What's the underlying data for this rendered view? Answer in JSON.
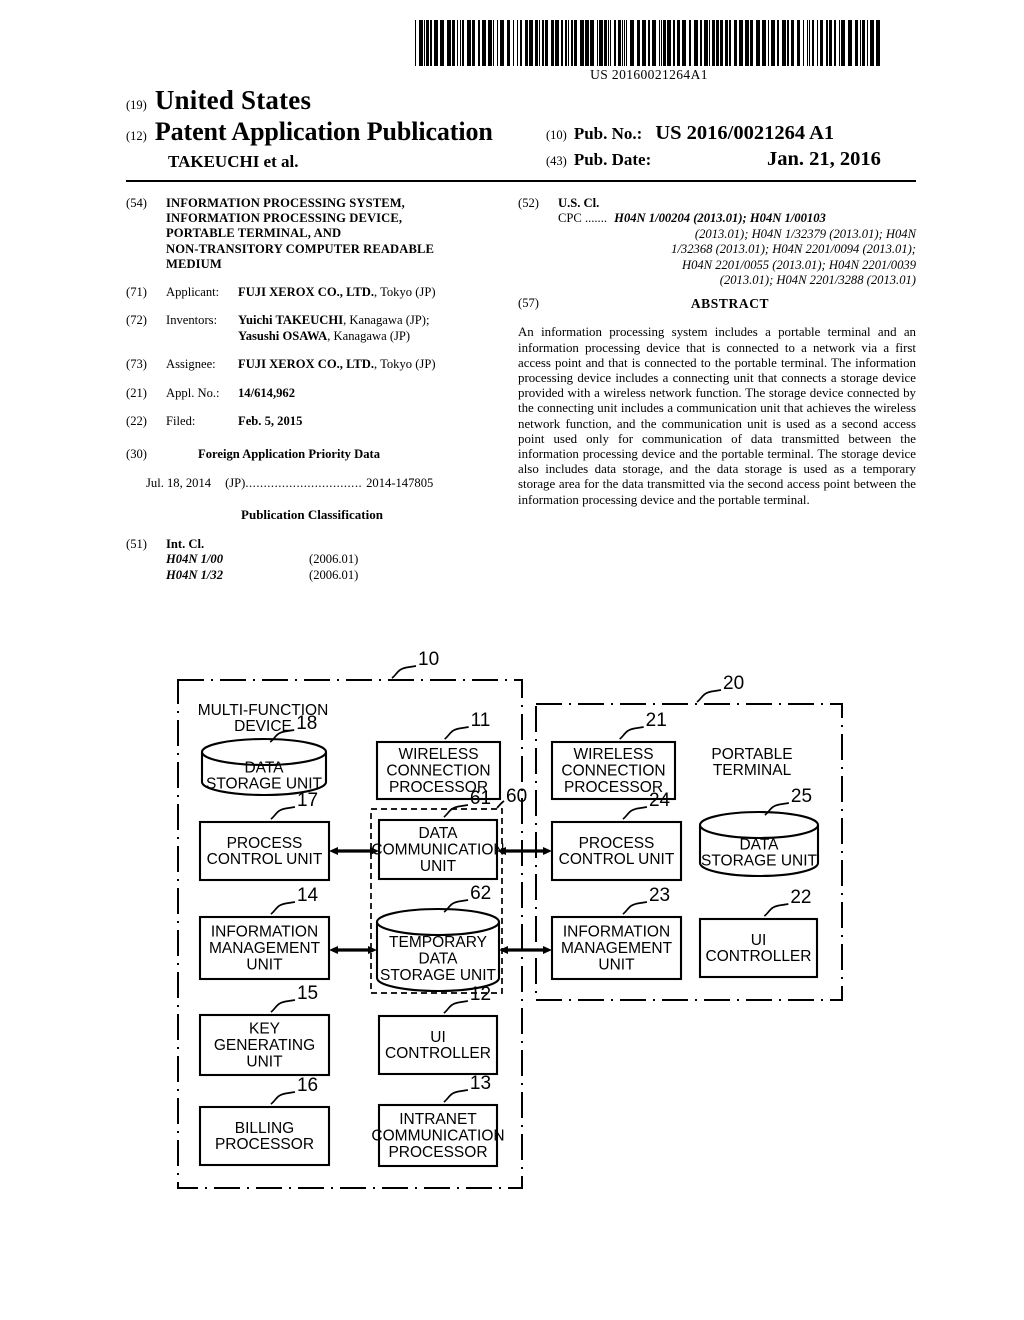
{
  "header": {
    "barcode_number": "US 20160021264A1",
    "country_code": "(19)",
    "country": "United States",
    "doc_code": "(12)",
    "doc_type": "Patent Application Publication",
    "author_line": "TAKEUCHI et al.",
    "pubno_code": "(10)",
    "pubno_label": "Pub. No.:",
    "pubno_value": "US 2016/0021264 A1",
    "pubdate_code": "(43)",
    "pubdate_label": "Pub. Date:",
    "pubdate_value": "Jan. 21, 2016"
  },
  "left_column": {
    "title_code": "(54)",
    "title_lines": [
      "INFORMATION PROCESSING SYSTEM,",
      "INFORMATION PROCESSING DEVICE,",
      "PORTABLE TERMINAL, AND",
      "NON-TRANSITORY COMPUTER READABLE",
      "MEDIUM"
    ],
    "applicant_code": "(71)",
    "applicant_label": "Applicant:",
    "applicant_name": "FUJI XEROX CO., LTD.",
    "applicant_loc": ", Tokyo (JP)",
    "inventors_code": "(72)",
    "inventors_label": "Inventors:",
    "inventors": [
      {
        "name": "Yuichi TAKEUCHI",
        "loc": ", Kanagawa (JP);"
      },
      {
        "name": "Yasushi OSAWA",
        "loc": ", Kanagawa (JP)"
      }
    ],
    "assignee_code": "(73)",
    "assignee_label": "Assignee:",
    "assignee_name": "FUJI XEROX CO., LTD.",
    "assignee_loc": ", Tokyo (JP)",
    "appno_code": "(21)",
    "appno_label": "Appl. No.:",
    "appno_value": "14/614,962",
    "filed_code": "(22)",
    "filed_label": "Filed:",
    "filed_value": "Feb. 5, 2015",
    "priority_code": "(30)",
    "priority_heading": "Foreign Application Priority Data",
    "priority_date": "Jul. 18, 2014",
    "priority_country": "(JP)",
    "priority_dots": "................................",
    "priority_number": "2014-147805",
    "pubclass_heading": "Publication Classification",
    "intcl_code": "(51)",
    "intcl_label": "Int. Cl.",
    "intcl_rows": [
      {
        "code": "H04N 1/00",
        "version": "(2006.01)"
      },
      {
        "code": "H04N 1/32",
        "version": "(2006.01)"
      }
    ]
  },
  "right_column": {
    "uscl_code": "(52)",
    "uscl_label": "U.S. Cl.",
    "cpc_prefix": "CPC .......",
    "cpc_lines": [
      "H04N 1/00204 (2013.01); H04N 1/00103",
      "(2013.01); H04N 1/32379 (2013.01); H04N",
      "1/32368 (2013.01); H04N 2201/0094 (2013.01);",
      "H04N 2201/0055 (2013.01); H04N 2201/0039",
      "(2013.01); H04N 2201/3288 (2013.01)"
    ],
    "abstract_code": "(57)",
    "abstract_title": "ABSTRACT",
    "abstract_text": "An information processing system includes a portable terminal and an information processing device that is connected to a network via a first access point and that is connected to the portable terminal. The information processing device includes a connecting unit that connects a storage device provided with a wireless network function. The storage device connected by the connecting unit includes a communication unit that achieves the wireless network function, and the communication unit is used as a second access point used only for communication of data transmitted between the information processing device and the portable terminal. The storage device also includes data storage, and the data storage is used as a temporary storage area for the data transmitted via the second access point between the information processing device and the portable terminal."
  },
  "figure": {
    "mfd_group_ref": "10",
    "mfd_group_label_lines": [
      "MULTI-FUNCTION",
      "DEVICE"
    ],
    "terminal_group_ref": "20",
    "terminal_group_label_lines": [
      "PORTABLE",
      "TERMINAL"
    ],
    "storage_group_ref": "60",
    "blocks": [
      {
        "ref": "18",
        "lines": [
          "DATA",
          "STORAGE UNIT"
        ],
        "shape": "cylinder"
      },
      {
        "ref": "11",
        "lines": [
          "WIRELESS",
          "CONNECTION",
          "PROCESSOR"
        ],
        "shape": "rect"
      },
      {
        "ref": "17",
        "lines": [
          "PROCESS",
          "CONTROL UNIT"
        ],
        "shape": "rect"
      },
      {
        "ref": "61",
        "lines": [
          "DATA",
          "COMMUNICATION",
          "UNIT"
        ],
        "shape": "rect"
      },
      {
        "ref": "14",
        "lines": [
          "INFORMATION",
          "MANAGEMENT",
          "UNIT"
        ],
        "shape": "rect"
      },
      {
        "ref": "62",
        "lines": [
          "TEMPORARY",
          "DATA",
          "STORAGE UNIT"
        ],
        "shape": "cylinder"
      },
      {
        "ref": "15",
        "lines": [
          "KEY",
          "GENERATING",
          "UNIT"
        ],
        "shape": "rect"
      },
      {
        "ref": "12",
        "lines": [
          "UI",
          "CONTROLLER"
        ],
        "shape": "rect"
      },
      {
        "ref": "16",
        "lines": [
          "BILLING",
          "PROCESSOR"
        ],
        "shape": "rect"
      },
      {
        "ref": "13",
        "lines": [
          "INTRANET",
          "COMMUNICATION",
          "PROCESSOR"
        ],
        "shape": "rect"
      },
      {
        "ref": "21",
        "lines": [
          "WIRELESS",
          "CONNECTION",
          "PROCESSOR"
        ],
        "shape": "rect"
      },
      {
        "ref": "24",
        "lines": [
          "PROCESS",
          "CONTROL UNIT"
        ],
        "shape": "rect"
      },
      {
        "ref": "25",
        "lines": [
          "DATA",
          "STORAGE UNIT"
        ],
        "shape": "cylinder"
      },
      {
        "ref": "23",
        "lines": [
          "INFORMATION",
          "MANAGEMENT",
          "UNIT"
        ],
        "shape": "rect"
      },
      {
        "ref": "22",
        "lines": [
          "UI",
          "CONTROLLER"
        ],
        "shape": "rect"
      }
    ]
  }
}
